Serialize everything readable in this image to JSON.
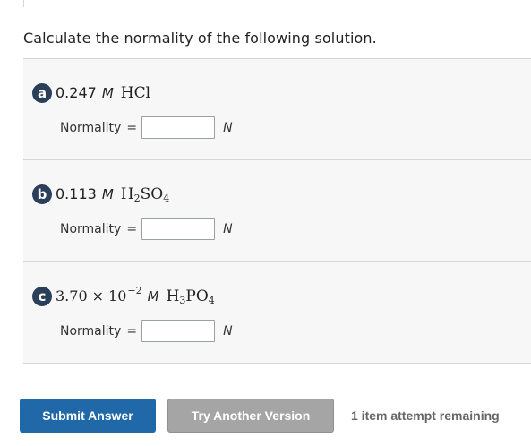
{
  "question": "Calculate the normality of the following solution.",
  "parts": [
    {
      "badge": "a",
      "value": "0.247",
      "molar_unit": "M",
      "compound": "HCl",
      "normality_label": "Normality",
      "equals": "=",
      "answer_value": "",
      "answer_unit": "N"
    },
    {
      "badge": "b",
      "value": "0.113",
      "molar_unit": "M",
      "compound_main": "H",
      "compound_sub1": "2",
      "compound_mid": "SO",
      "compound_sub2": "4",
      "normality_label": "Normality",
      "equals": "=",
      "answer_value": "",
      "answer_unit": "N"
    },
    {
      "badge": "c",
      "mantissa": "3.70",
      "times": "×",
      "base": "10",
      "exponent": "−2",
      "molar_unit": "M",
      "compound_main": "H",
      "compound_sub1": "3",
      "compound_mid": "PO",
      "compound_sub2": "4",
      "normality_label": "Normality",
      "equals": "=",
      "answer_value": "",
      "answer_unit": "N"
    }
  ],
  "buttons": {
    "submit": "Submit Answer",
    "try_another": "Try Another Version"
  },
  "attempts_text": "1 item attempt remaining",
  "colors": {
    "badge": "#2a3f5a",
    "submit": "#2068a8",
    "try_another": "#a5a5a5",
    "part_background": "#f7f7f7"
  }
}
